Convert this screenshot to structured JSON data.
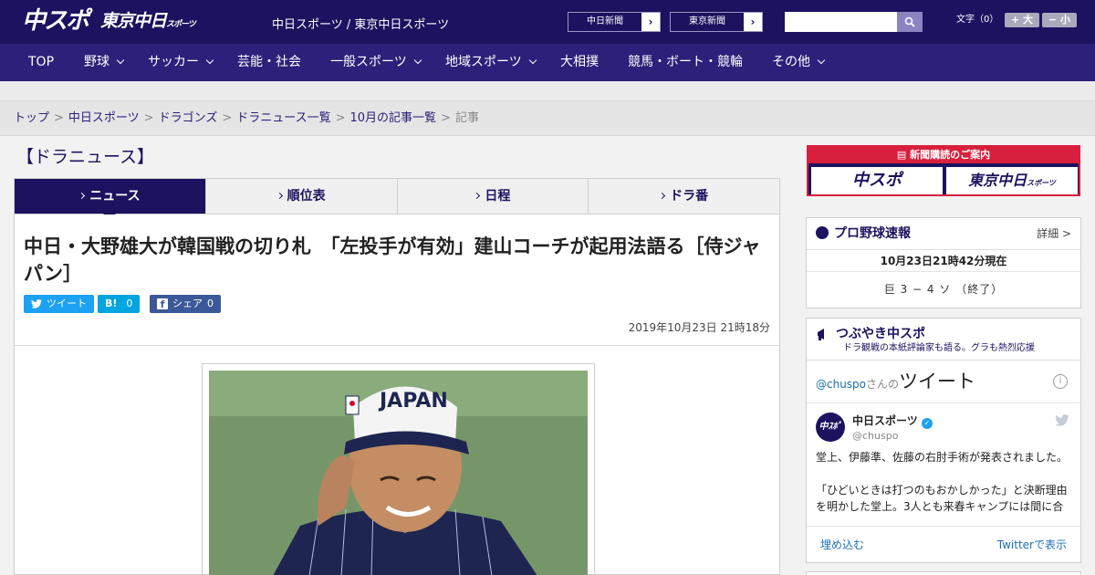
{
  "header": {
    "logo_main": "中スポ",
    "logo_tokyo": "東京中日",
    "logo_tokyo_sub": "スポーツ",
    "site_title": "中日スポーツ / 東京中日スポーツ",
    "paper_links": [
      {
        "label": "中日新聞"
      },
      {
        "label": "東京新聞"
      }
    ],
    "search_placeholder": "",
    "font_size_label": "文字（0）",
    "font_bigger": "+ 大",
    "font_smaller": "− 小"
  },
  "nav": {
    "items": [
      {
        "label": "TOP"
      },
      {
        "label": "野球"
      },
      {
        "label": "サッカー"
      },
      {
        "label": "芸能・社会"
      },
      {
        "label": "一般スポーツ"
      },
      {
        "label": "地域スポーツ"
      },
      {
        "label": "大相撲"
      },
      {
        "label": "競馬・ボート・競輪"
      },
      {
        "label": "その他"
      }
    ]
  },
  "breadcrumb": {
    "items": [
      {
        "label": "トップ"
      },
      {
        "label": "中日スポーツ"
      },
      {
        "label": "ドラゴンズ"
      },
      {
        "label": "ドラニュース一覧"
      },
      {
        "label": "10月の記事一覧"
      }
    ],
    "current": "記事"
  },
  "section_title": "【ドラニュース】",
  "tabs": [
    {
      "label": "ニュース"
    },
    {
      "label": "順位表"
    },
    {
      "label": "日程"
    },
    {
      "label": "ドラ番"
    }
  ],
  "article": {
    "headline": "中日・大野雄大が韓国戦の切り札　「左投手が有効」建山コーチが起用法語る［侍ジャパン］",
    "share": {
      "tweet": "ツイート",
      "hatena": "B!",
      "hatena_count": "0",
      "facebook": "シェア",
      "facebook_count": "0"
    },
    "date": "2019年10月23日 21時18分",
    "photo_cap_text": "JAPAN"
  },
  "sidebar": {
    "subscribe": {
      "header": "新聞購読のご案内",
      "chuspo": "中スポ",
      "tokyo": "東京中日",
      "tokyo_sub": "スポーツ"
    },
    "baseball": {
      "title": "プロ野球速報",
      "detail_link": "詳細 >",
      "time": "10月23日21時42分現在",
      "score": "巨 3 − 4 ソ （終了）"
    },
    "tweets": {
      "title": "つぶやき中スポ",
      "subtitle": "ドラ観戦の本紙評論家も語る。グラも熱烈応援",
      "handle": "@chuspo",
      "handle_suffix": "さんの",
      "heading": "ツイート",
      "account_name": "中日スポーツ",
      "account_handle": "@chuspo",
      "body1": "堂上、伊藤準、佐藤の右肘手術が発表されました。",
      "body2": "「ひどいときは打つのもおかしかった」と決断理由を明かした堂上。3人とも来春キャンプには間に合",
      "embed": "埋め込む",
      "view": "Twitterで表示"
    }
  },
  "colors": {
    "brand": "#1c125f",
    "nav": "#2b207a",
    "accent_red": "#d81f3d",
    "twitter": "#1da1f2",
    "hatena": "#00a4de",
    "facebook": "#3b5998"
  }
}
